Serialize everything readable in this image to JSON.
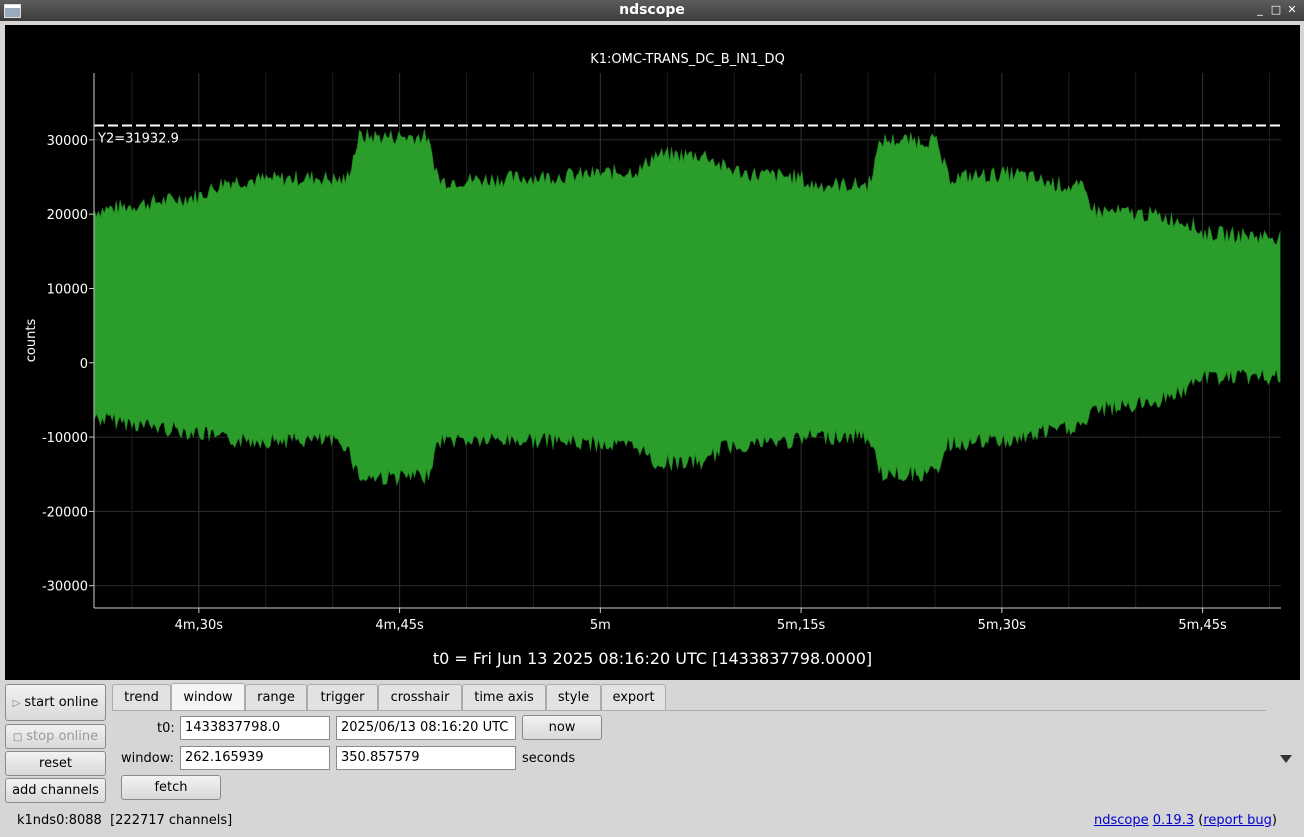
{
  "window": {
    "title": "ndscope",
    "controls": [
      "_",
      "□",
      "✕"
    ]
  },
  "chart_data": {
    "type": "area",
    "title": "K1:OMC-TRANS_DC_B_IN1_DQ",
    "ylabel": "counts",
    "xlabel": "",
    "ylim": [
      -33000,
      39000
    ],
    "xlim": [
      262.165939,
      350.857579
    ],
    "yticks": [
      30000,
      20000,
      10000,
      0,
      -10000,
      -20000,
      -30000
    ],
    "ytick_labels": [
      "30000",
      "20000",
      "10000",
      "0",
      "-10000",
      "-20000",
      "-30000"
    ],
    "xticks": [
      270,
      285,
      300,
      315,
      330,
      345
    ],
    "xtick_labels": [
      "4m,30s",
      "4m,45s",
      "5m",
      "5m,15s",
      "5m,30s",
      "5m,45s"
    ],
    "grid": true,
    "series": [
      {
        "color": "#2a9d2a",
        "x": [
          262.2,
          266.0,
          270.0,
          272.0,
          279.0,
          281.0,
          282.0,
          287.0,
          288.0,
          295.0,
          300.0,
          303.0,
          304.0,
          308.0,
          309.0,
          311.0,
          315.0,
          315.5,
          320.0,
          321.0,
          325.0,
          326.0,
          331.0,
          333.0,
          336.0,
          337.0,
          341.0,
          344.0,
          345.0,
          350.8
        ],
        "upper": [
          20000,
          21000,
          22000,
          24000,
          24500,
          24000,
          30000,
          30000,
          24000,
          24500,
          25000,
          25500,
          27500,
          27500,
          26000,
          25000,
          24500,
          23500,
          23500,
          29500,
          29500,
          24500,
          25000,
          24000,
          23000,
          20000,
          19500,
          18500,
          17000,
          16500
        ],
        "lower": [
          -7000,
          -8000,
          -9000,
          -10000,
          -10000,
          -10500,
          -15000,
          -15000,
          -10000,
          -10000,
          -10500,
          -11000,
          -13000,
          -13000,
          -11000,
          -10500,
          -10000,
          -9500,
          -9500,
          -14500,
          -14500,
          -10500,
          -10000,
          -9000,
          -8000,
          -6000,
          -5000,
          -3000,
          -1500,
          -1500
        ]
      }
    ],
    "threshold": {
      "y": 31932.9,
      "label": "Y2=31932.9",
      "color": "#ffffff"
    }
  },
  "t0_label": "t0 = Fri Jun 13 2025 08:16:20 UTC [1433837798.0000]",
  "sidebar": {
    "start_online": "start online",
    "stop_online": "stop online",
    "reset": "reset",
    "add_channels": "add channels"
  },
  "tabs": [
    "trend",
    "window",
    "range",
    "trigger",
    "crosshair",
    "time axis",
    "style",
    "export"
  ],
  "active_tab": "window",
  "window_tab": {
    "t0_label": "t0:",
    "t0_gps": "1433837798.0",
    "t0_utc": "2025/06/13 08:16:20 UTC",
    "now_label": "now",
    "window_label": "window:",
    "window_start": "262.165939",
    "window_end": "350.857579",
    "seconds_label": "seconds",
    "fetch_label": "fetch"
  },
  "status": {
    "server": "k1nds0:8088",
    "channels": "[222717 channels]",
    "app_name": "ndscope",
    "version": "0.19.3",
    "paren_open": " (",
    "report_bug": "report bug",
    "paren_close": ")"
  }
}
